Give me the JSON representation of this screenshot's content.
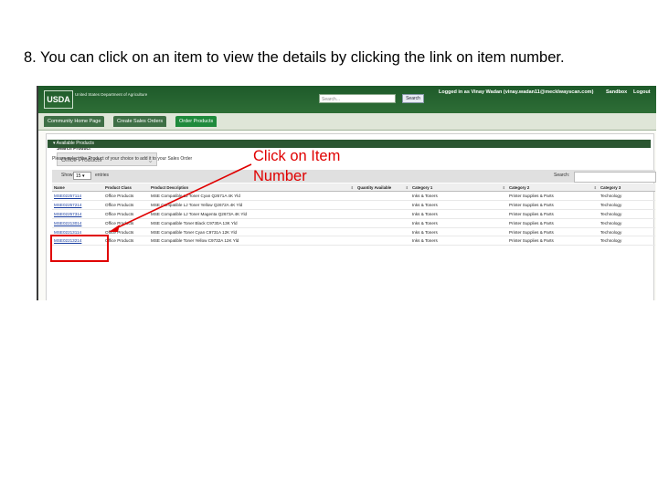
{
  "slide": {
    "title": "8. You can click on an item to view the details by clicking the link on item number."
  },
  "header": {
    "logo": "USDA",
    "agency": "United States Department of Agriculture",
    "search_placeholder": "Search...",
    "search_button": "Search",
    "logged_in": "Logged in as Vinay Wadan (vinay.wadan11@mecklwayscan.com)",
    "sandbox": "Sandbox",
    "logout": "Logout"
  },
  "tabs": [
    {
      "label": "Community Home Page",
      "active": false
    },
    {
      "label": "Create Sales Orders",
      "active": false
    },
    {
      "label": "Order Products",
      "active": true
    }
  ],
  "search_product": {
    "label": "Search Product",
    "selected": "Office Products"
  },
  "available_products": {
    "header": "▾ Available Products",
    "instruction": "Please select the Product of your choice to add it to your Sales Order",
    "show_label": "Show",
    "show_value": "15 ▾",
    "entries_label": "entries",
    "search_label": "Search:",
    "columns": [
      "Name",
      "Product Class",
      "Product Description",
      "Quantity Available",
      "Category 1",
      "Category 2",
      "Category 3"
    ],
    "rows": [
      [
        "MSE02257114",
        "Office Products",
        "MSE Compatible LJ Toner Cyan Q2671A 4K Yld",
        "",
        "Inks & Toners",
        "Printer Supplies & Parts",
        "Technology"
      ],
      [
        "MSE02257214",
        "Office Products",
        "MSE Compatible LJ Toner Yellow Q2672A 4K Yld",
        "",
        "Inks & Toners",
        "Printer Supplies & Parts",
        "Technology"
      ],
      [
        "MSE02257314",
        "Office Products",
        "MSE Compatible LJ Toner Magenta Q2673A 4K Yld",
        "",
        "Inks & Toners",
        "Printer Supplies & Parts",
        "Technology"
      ],
      [
        "MSE02213014",
        "Office Products",
        "MSE Compatible Toner Black C9730A 13K Yld",
        "",
        "Inks & Toners",
        "Printer Supplies & Parts",
        "Technology"
      ],
      [
        "MSE02213114",
        "Office Products",
        "MSE Compatible Toner Cyan C9731A 12K Yld",
        "",
        "Inks & Toners",
        "Printer Supplies & Parts",
        "Technology"
      ],
      [
        "MSE02213214",
        "Office Products",
        "MSE Compatible Toner Yellow C9732A 12K Yld",
        "",
        "Inks & Toners",
        "Printer Supplies & Parts",
        "Technology"
      ]
    ]
  },
  "annotation": {
    "line1": "Click on Item",
    "line2": "Number",
    "color": "#e00000"
  },
  "colors": {
    "header_green": "#2e6e36",
    "active_tab": "#1f8a3c",
    "section_bar": "#2b5631",
    "link": "#1a3ea0"
  }
}
